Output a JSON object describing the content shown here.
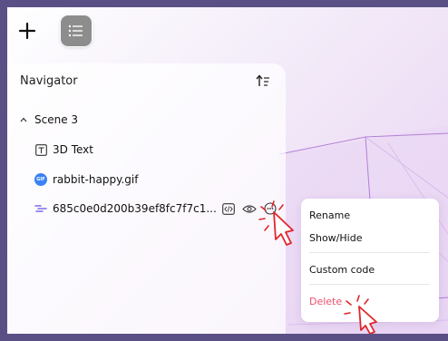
{
  "toolbar": {
    "add_icon": "plus-icon",
    "navigator_toggle_icon": "list-icon"
  },
  "navigator": {
    "title": "Navigator",
    "sort_icon": "sort-arrow-icon",
    "tree": {
      "scene": {
        "label": "Scene 3",
        "icon": "chevron-up-icon"
      },
      "items": [
        {
          "label": "3D Text",
          "icon": "text-box-icon"
        },
        {
          "label": "rabbit-happy.gif",
          "icon": "gif-icon",
          "badge_text": "GIF"
        },
        {
          "label": "685c0e0d200b39ef8fc7f7c1...",
          "icon": "custom-code-icon",
          "actions": [
            "code-icon",
            "eye-icon",
            "more-options-icon"
          ]
        }
      ]
    }
  },
  "context_menu": {
    "items": [
      "Rename",
      "Show/Hide",
      "Custom code",
      "Delete"
    ]
  },
  "colors": {
    "frame": "#5b5085",
    "delete": "#f0506e",
    "cursor_outline": "#e0262a",
    "canvas_lines": "#b27fd6"
  }
}
